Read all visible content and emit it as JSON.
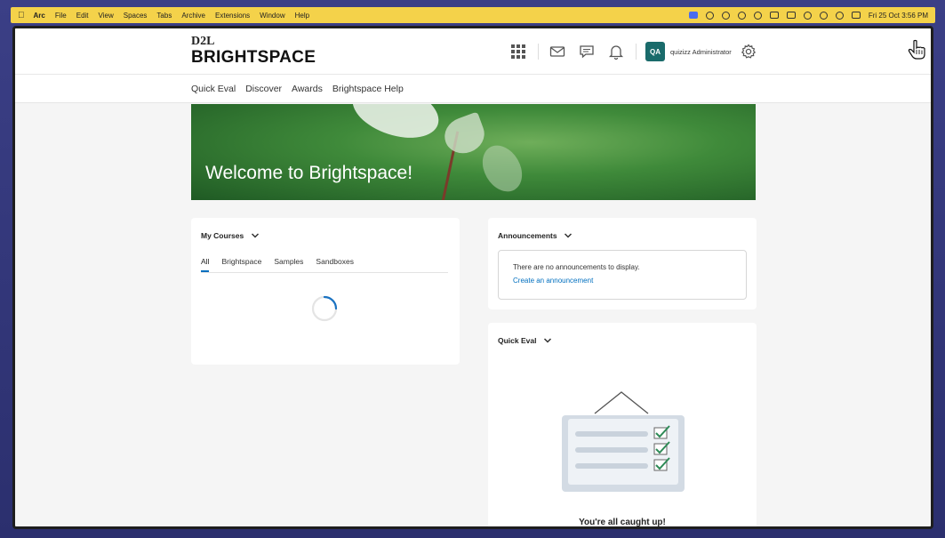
{
  "menubar": {
    "app": "Arc",
    "items": [
      "File",
      "Edit",
      "View",
      "Spaces",
      "Tabs",
      "Archive",
      "Extensions",
      "Window",
      "Help"
    ],
    "clock": "Fri 25 Oct  3:56 PM"
  },
  "header": {
    "logo_top": "D2L",
    "logo_main": "BRIGHTSPACE",
    "avatar_initials": "QA",
    "user_name": "quizizz Administrator"
  },
  "nav": {
    "items": [
      "Quick Eval",
      "Discover",
      "Awards",
      "Brightspace Help"
    ]
  },
  "hero": {
    "title": "Welcome to Brightspace!"
  },
  "my_courses": {
    "title": "My Courses",
    "tabs": [
      "All",
      "Brightspace",
      "Samples",
      "Sandboxes"
    ],
    "active_tab": "All"
  },
  "announcements": {
    "title": "Announcements",
    "empty_text": "There are no announcements to display.",
    "create_link": "Create an announcement"
  },
  "quick_eval": {
    "title": "Quick Eval",
    "caught_up": "You're all caught up!"
  },
  "colors": {
    "menubar": "#f4d24a",
    "accent": "#006fbf",
    "avatar": "#1a6b6b"
  }
}
